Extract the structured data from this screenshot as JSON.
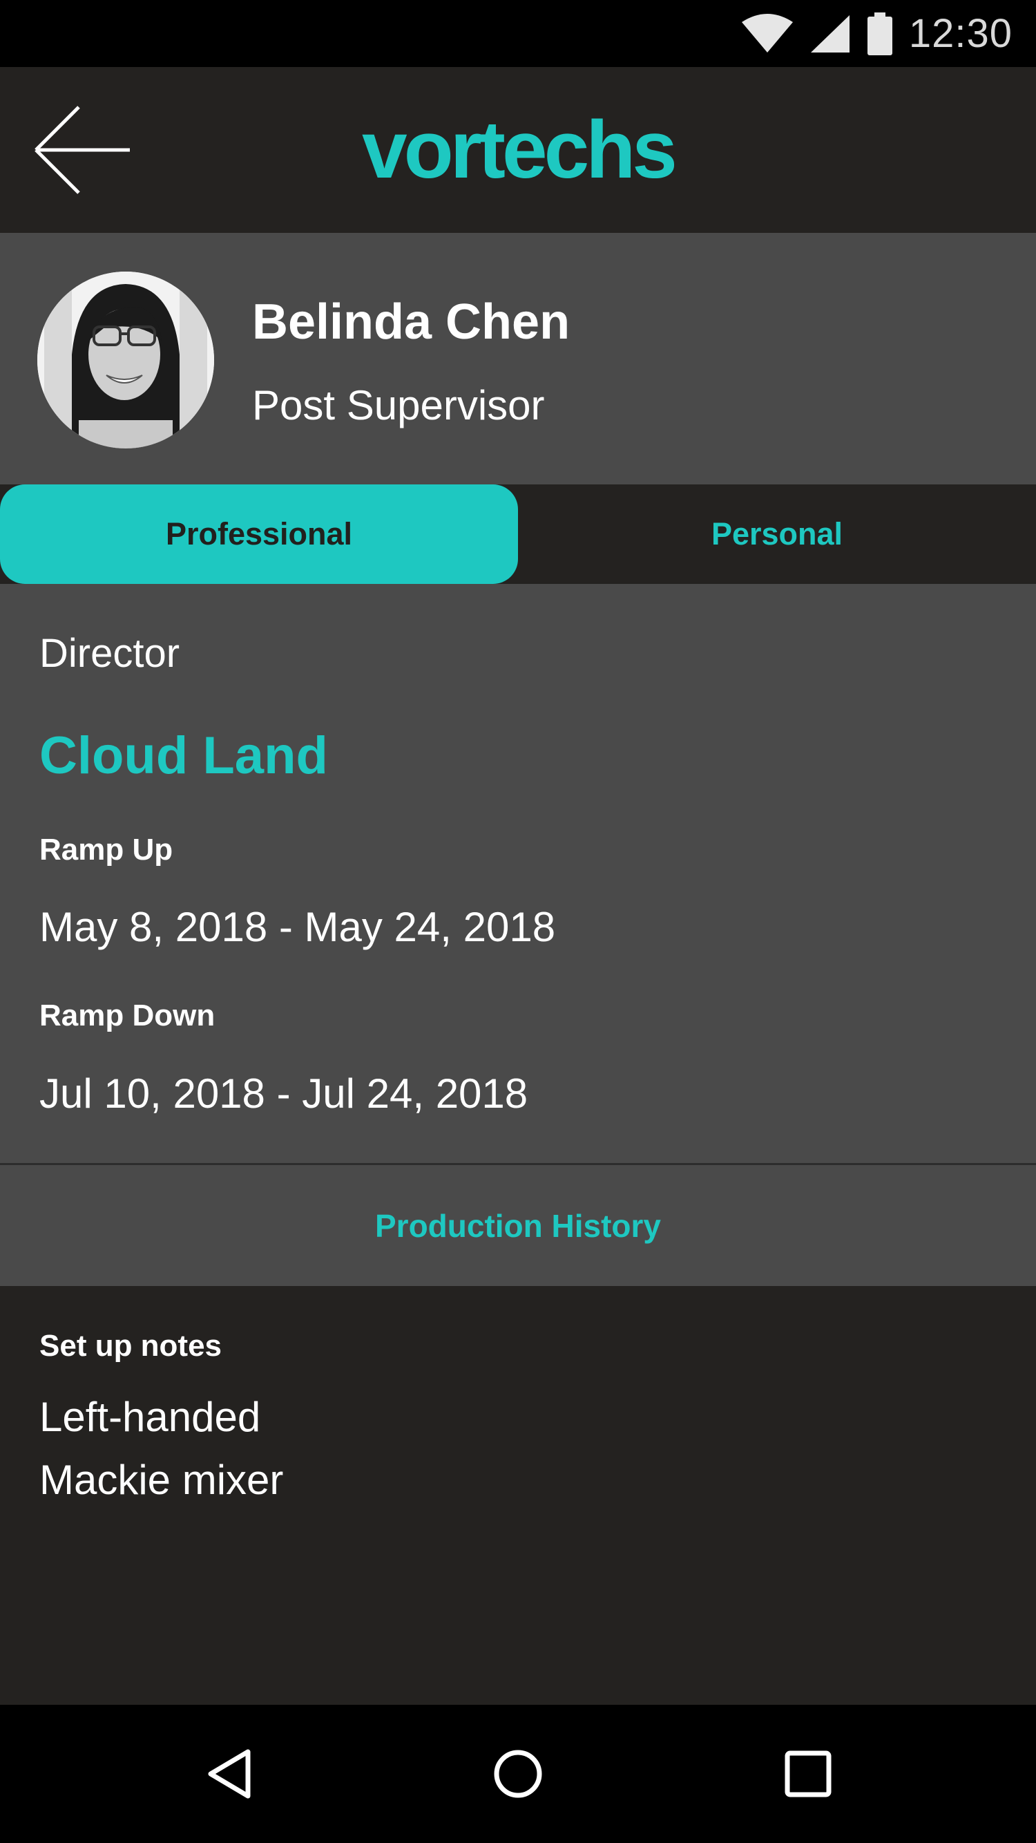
{
  "status_bar": {
    "time": "12:30",
    "icons": [
      "wifi-icon",
      "signal-icon",
      "battery-icon"
    ]
  },
  "header": {
    "back_icon": "arrow-left-icon",
    "brand": "vortechs"
  },
  "profile": {
    "name": "Belinda Chen",
    "title": "Post Supervisor",
    "avatar_icon": "avatar-photo"
  },
  "tabs": [
    {
      "label": "Professional",
      "active": true
    },
    {
      "label": "Personal",
      "active": false
    }
  ],
  "details": {
    "role": "Director",
    "project": "Cloud Land",
    "ramp_up_label": "Ramp Up",
    "ramp_up_value": "May 8, 2018 - May 24, 2018",
    "ramp_down_label": "Ramp Down",
    "ramp_down_value": "Jul 10, 2018 - Jul 24, 2018"
  },
  "production_history": "Production History",
  "notes": {
    "label": "Set up notes",
    "lines": [
      "Left-handed",
      "Mackie mixer"
    ]
  },
  "nav_bar": {
    "icons": [
      "back-triangle-icon",
      "home-circle-icon",
      "recents-square-icon"
    ]
  },
  "colors": {
    "accent": "#1ec8c1",
    "panel": "#4a4a4a",
    "dark": "#242220",
    "bar": "#000000"
  }
}
